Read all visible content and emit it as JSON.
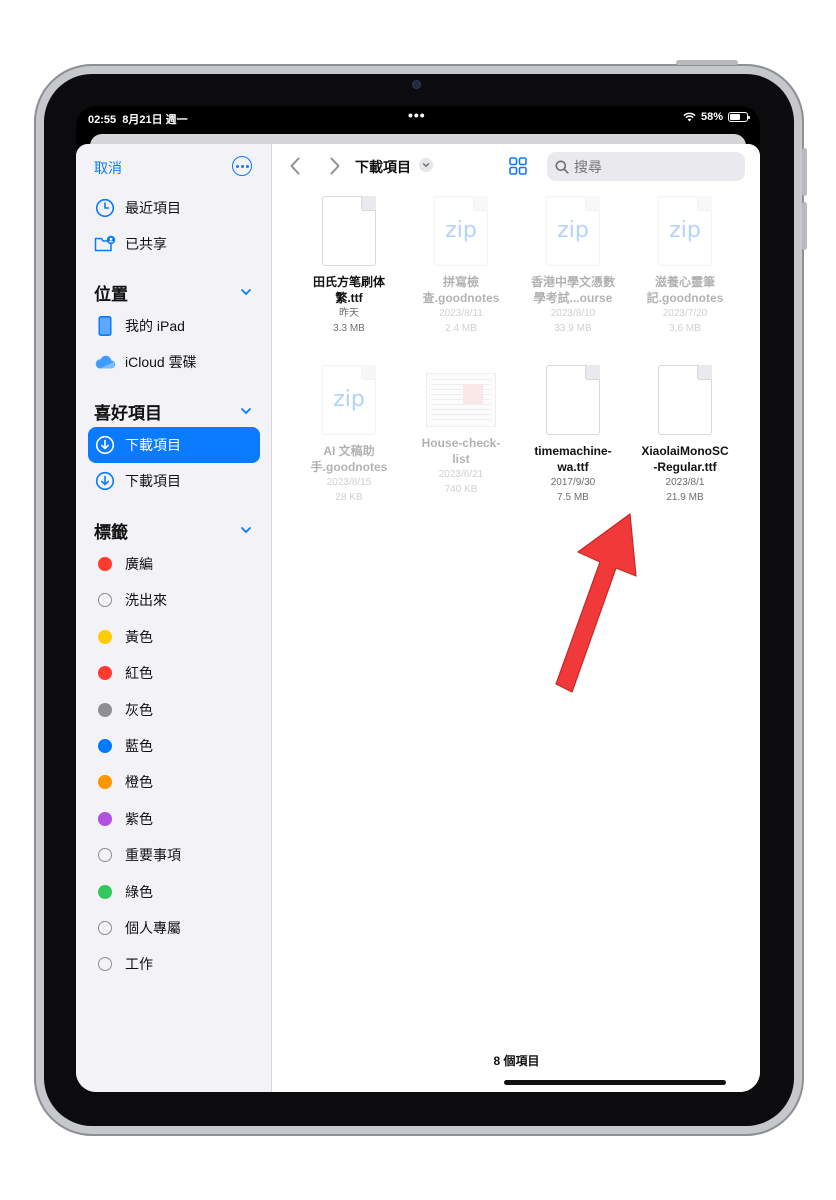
{
  "status": {
    "time": "02:55",
    "date": "8月21日 週一",
    "dots": "•••",
    "battery": "58%"
  },
  "sidebar": {
    "cancel": "取消",
    "top_items": [
      {
        "label": "最近項目",
        "icon": "clock-icon"
      },
      {
        "label": "已共享",
        "icon": "shared-folder-icon"
      }
    ],
    "locations_title": "位置",
    "locations": [
      {
        "label": "我的 iPad",
        "icon": "ipad-icon"
      },
      {
        "label": "iCloud 雲碟",
        "icon": "icloud-icon"
      }
    ],
    "favorites_title": "喜好項目",
    "favorites": [
      {
        "label": "下載項目",
        "icon": "download-icon",
        "active": true
      },
      {
        "label": "下載項目",
        "icon": "download-icon",
        "active": false
      }
    ],
    "tags_title": "標籤",
    "tags": [
      {
        "label": "廣編",
        "color": "#ff3b30"
      },
      {
        "label": "洗出來",
        "color": ""
      },
      {
        "label": "黃色",
        "color": "#ffcc00"
      },
      {
        "label": "紅色",
        "color": "#ff3b30"
      },
      {
        "label": "灰色",
        "color": "#8e8e93"
      },
      {
        "label": "藍色",
        "color": "#007aff"
      },
      {
        "label": "橙色",
        "color": "#ff9500"
      },
      {
        "label": "紫色",
        "color": "#af52de"
      },
      {
        "label": "重要事項",
        "color": ""
      },
      {
        "label": "綠色",
        "color": "#34c759"
      },
      {
        "label": "個人專屬",
        "color": ""
      },
      {
        "label": "工作",
        "color": ""
      }
    ]
  },
  "toolbar": {
    "folder_title": "下載項目",
    "search_placeholder": "搜尋"
  },
  "files": [
    {
      "name1": "田氏方笔刷体",
      "name2": "繁.ttf",
      "date": "昨天",
      "size": "3.3 MB",
      "kind": "doc",
      "dim": false
    },
    {
      "name1": "拼寫檢",
      "name2": "查.goodnotes",
      "date": "2023/8/11",
      "size": "2.4 MB",
      "kind": "zip",
      "dim": true
    },
    {
      "name1": "香港中學文憑數",
      "name2": "學考試...ourse",
      "date": "2023/8/10",
      "size": "33.9 MB",
      "kind": "zip",
      "dim": true
    },
    {
      "name1": "滋養心靈筆",
      "name2": "記.goodnotes",
      "date": "2023/7/20",
      "size": "3.6 MB",
      "kind": "zip",
      "dim": true
    },
    {
      "name1": "AI 文稿助",
      "name2": "手.goodnotes",
      "date": "2023/8/15",
      "size": "28 KB",
      "kind": "zip",
      "dim": true
    },
    {
      "name1": "House-check-",
      "name2": "list",
      "date": "2023/6/21",
      "size": "740 KB",
      "kind": "sheet",
      "dim": true
    },
    {
      "name1": "timemachine-",
      "name2": "wa.ttf",
      "date": "2017/9/30",
      "size": "7.5 MB",
      "kind": "doc",
      "dim": false
    },
    {
      "name1": "XiaolaiMonoSC",
      "name2": "-Regular.ttf",
      "date": "2023/8/1",
      "size": "21.9 MB",
      "kind": "doc",
      "dim": false
    }
  ],
  "zip_label": "zip",
  "item_count": "8 個項目",
  "colors": {
    "accent": "#0a7aff",
    "arrow": "#f2393a"
  }
}
